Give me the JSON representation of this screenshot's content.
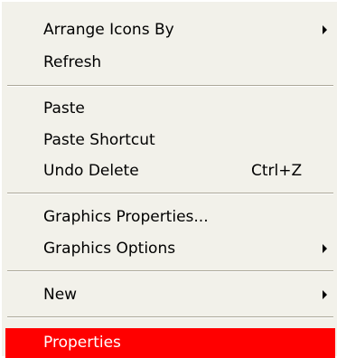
{
  "context_menu": {
    "items": [
      {
        "label": "Arrange Icons By",
        "shortcut": "",
        "submenu": true
      },
      {
        "label": "Refresh",
        "shortcut": "",
        "submenu": false
      },
      {
        "label": "Paste",
        "shortcut": "",
        "submenu": false
      },
      {
        "label": "Paste Shortcut",
        "shortcut": "",
        "submenu": false
      },
      {
        "label": "Undo Delete",
        "shortcut": "Ctrl+Z",
        "submenu": false
      },
      {
        "label": "Graphics Properties...",
        "shortcut": "",
        "submenu": false
      },
      {
        "label": "Graphics Options",
        "shortcut": "",
        "submenu": true
      },
      {
        "label": "New",
        "shortcut": "",
        "submenu": true
      },
      {
        "label": "Properties",
        "shortcut": "",
        "submenu": false,
        "highlighted": true
      }
    ],
    "colors": {
      "menu_background": "#f2f1ea",
      "highlight": "#ff0000",
      "separator": "#aca899"
    }
  }
}
